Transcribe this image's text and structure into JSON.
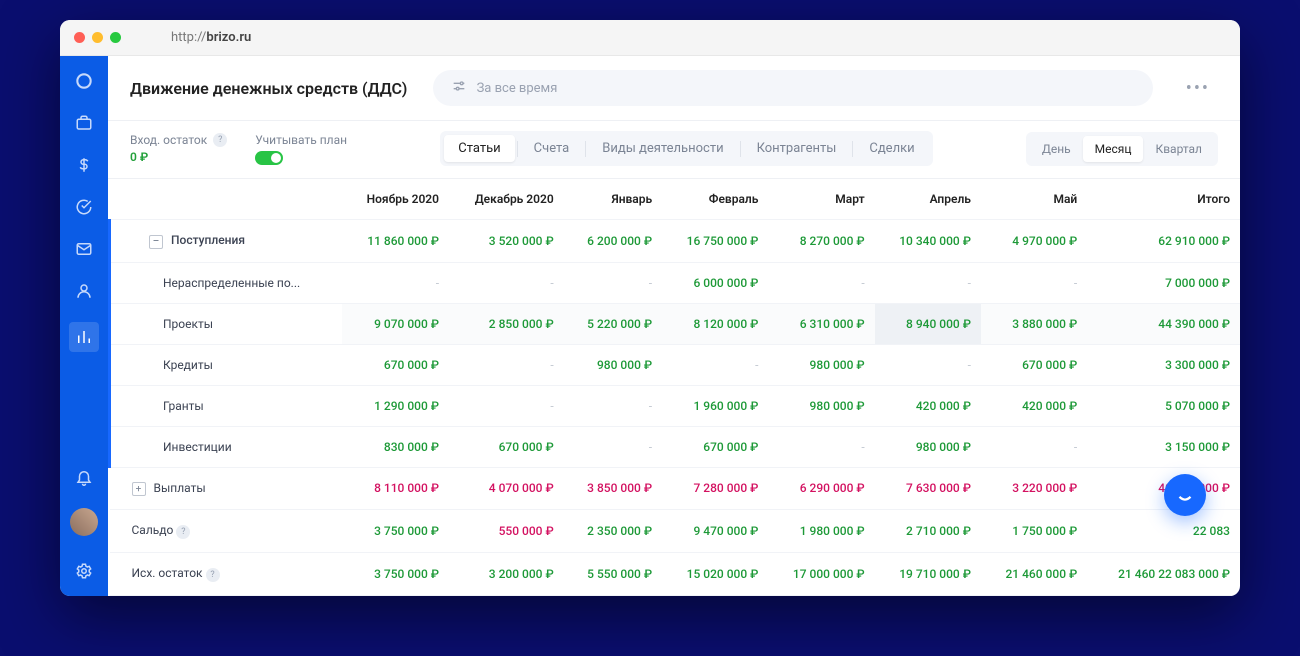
{
  "url_prefix": "http://",
  "url_host": "brizo.ru",
  "page_title": "Движение денежных средств (ДДС)",
  "search_placeholder": "За все время",
  "balance": {
    "label": "Вход. остаток",
    "value": "0 ₽"
  },
  "plan_label": "Учитывать план",
  "category_tabs": [
    "Статьи",
    "Счета",
    "Виды деятельности",
    "Контрагенты",
    "Сделки"
  ],
  "category_active": 0,
  "period_tabs": [
    "День",
    "Месяц",
    "Квартал"
  ],
  "period_active": 1,
  "columns": [
    "",
    "Ноябрь 2020",
    "Декабрь 2020",
    "Январь",
    "Февраль",
    "Март",
    "Апрель",
    "Май",
    "Итого"
  ],
  "rows": [
    {
      "type": "lvl1",
      "expand": "–",
      "label": "Поступления",
      "values": [
        "11 860 000 ₽",
        "3 520 000 ₽",
        "6 200 000 ₽",
        "16 750 000 ₽",
        "8 270 000 ₽",
        "10 340 000 ₽",
        "4 970 000 ₽",
        "62 910 000 ₽"
      ],
      "style": "pos",
      "highlight": false
    },
    {
      "type": "sub",
      "label": "Нераспределенные по...",
      "values": [
        "-",
        "-",
        "-",
        "6 000 000 ₽",
        "-",
        "-",
        "-",
        "7 000 000 ₽"
      ],
      "style": "pos",
      "highlight": false
    },
    {
      "type": "sub",
      "label": "Проекты",
      "values": [
        "9 070 000 ₽",
        "2 850 000 ₽",
        "5 220 000 ₽",
        "8 120 000 ₽",
        "6 310 000 ₽",
        "8 940 000 ₽",
        "3 880 000 ₽",
        "44 390 000 ₽"
      ],
      "style": "pos",
      "highlight": true
    },
    {
      "type": "sub",
      "label": "Кредиты",
      "values": [
        "670 000 ₽",
        "-",
        "980 000 ₽",
        "-",
        "980 000 ₽",
        "-",
        "670 000 ₽",
        "3 300 000 ₽"
      ],
      "style": "pos",
      "highlight": false
    },
    {
      "type": "sub",
      "label": "Гранты",
      "values": [
        "1 290 000 ₽",
        "-",
        "-",
        "1 960 000 ₽",
        "980 000 ₽",
        "420 000 ₽",
        "420 000 ₽",
        "5 070 000 ₽"
      ],
      "style": "pos",
      "highlight": false
    },
    {
      "type": "sub",
      "label": "Инвестиции",
      "values": [
        "830 000 ₽",
        "670 000 ₽",
        "-",
        "670 000 ₽",
        "-",
        "980 000 ₽",
        "-",
        "3 150 000 ₽"
      ],
      "style": "pos",
      "highlight": false
    },
    {
      "type": "group",
      "expand": "+",
      "label": "Выплаты",
      "values": [
        "8 110 000 ₽",
        "4 070 000 ₽",
        "3 850 000 ₽",
        "7 280 000 ₽",
        "6 290 000 ₽",
        "7 630 000 ₽",
        "3 220 000 ₽",
        "40 827 000 ₽"
      ],
      "style": "neg"
    },
    {
      "type": "group",
      "label": "Сальдо",
      "help": true,
      "values": [
        "3 750 000 ₽",
        "550 000 ₽",
        "2 350 000 ₽",
        "9 470 000 ₽",
        "1 980 000 ₽",
        "2 710 000 ₽",
        "1 750 000 ₽",
        "22 083"
      ],
      "styles": [
        "pos",
        "neg",
        "pos",
        "pos",
        "pos",
        "pos",
        "pos",
        "pos"
      ]
    },
    {
      "type": "group",
      "label": "Исх. остаток",
      "help": true,
      "values": [
        "3 750 000 ₽",
        "3 200 000 ₽",
        "5 550 000 ₽",
        "15 020 000 ₽",
        "17 000 000 ₽",
        "19 710 000 ₽",
        "21 460 000 ₽",
        "21 460  22 083 000 ₽"
      ],
      "style": "pos"
    }
  ]
}
